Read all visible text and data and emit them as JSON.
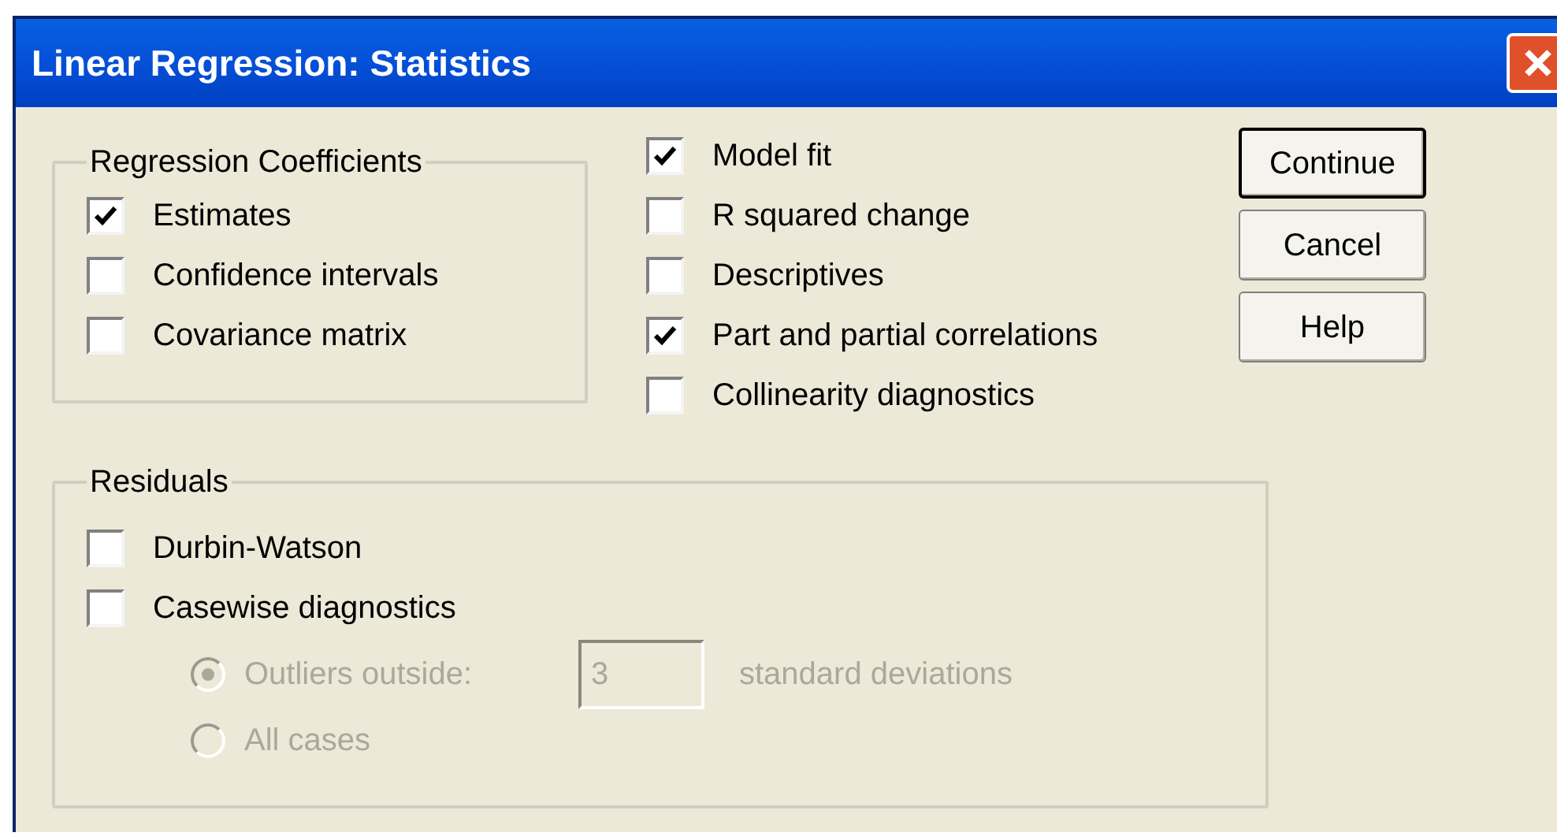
{
  "window": {
    "title": "Linear Regression: Statistics"
  },
  "regression_coefficients": {
    "title": "Regression Coefficients",
    "options": [
      {
        "label": "Estimates",
        "checked": true
      },
      {
        "label": "Confidence intervals",
        "checked": false
      },
      {
        "label": "Covariance matrix",
        "checked": false
      }
    ]
  },
  "statistics_options": [
    {
      "label": "Model fit",
      "checked": true
    },
    {
      "label": "R squared change",
      "checked": false
    },
    {
      "label": "Descriptives",
      "checked": false
    },
    {
      "label": "Part and partial correlations",
      "checked": true
    },
    {
      "label": "Collinearity diagnostics",
      "checked": false
    }
  ],
  "buttons": [
    {
      "label": "Continue",
      "default": true
    },
    {
      "label": "Cancel",
      "default": false
    },
    {
      "label": "Help",
      "default": false
    }
  ],
  "residuals": {
    "title": "Residuals",
    "options": [
      {
        "label": "Durbin-Watson",
        "checked": false
      },
      {
        "label": "Casewise diagnostics",
        "checked": false
      }
    ],
    "casewise": {
      "disabled": true,
      "radios": [
        {
          "label": "Outliers outside:",
          "selected": true,
          "field": {
            "value": "3",
            "suffix": "standard deviations"
          }
        },
        {
          "label": "All cases",
          "selected": false
        }
      ]
    }
  }
}
